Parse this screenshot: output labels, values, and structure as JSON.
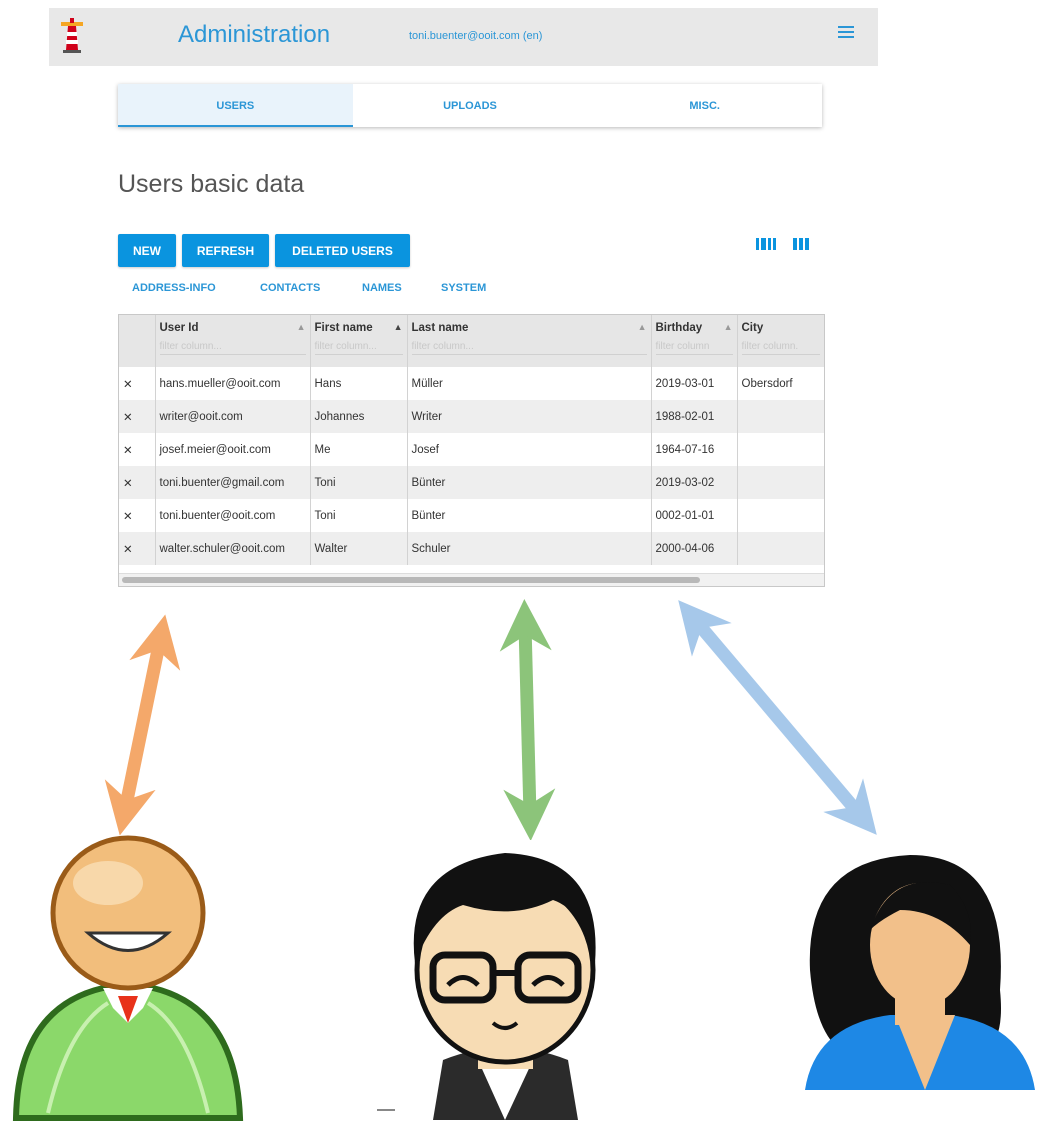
{
  "header": {
    "title": "Administration",
    "user": "toni.buenter@ooit.com (en)",
    "menu_icon": "hamburger-icon",
    "logo_icon": "lighthouse-logo-icon"
  },
  "tabs": [
    {
      "label": "USERS",
      "active": true
    },
    {
      "label": "UPLOADS",
      "active": false
    },
    {
      "label": "MISC.",
      "active": false
    }
  ],
  "page_title": "Users basic data",
  "toolbar": {
    "new_label": "NEW",
    "refresh_label": "REFRESH",
    "deleted_label": "DELETED USERS",
    "view_icons": [
      "columns-view-icon",
      "grid-view-icon"
    ]
  },
  "column_groups": [
    "ADDRESS-INFO",
    "CONTACTS",
    "NAMES",
    "SYSTEM"
  ],
  "table": {
    "columns": [
      {
        "label": "User Id",
        "filter": "filter column..."
      },
      {
        "label": "First name",
        "filter": "filter column..."
      },
      {
        "label": "Last name",
        "filter": "filter column..."
      },
      {
        "label": "Birthday",
        "filter": "filter column"
      },
      {
        "label": "City",
        "filter": "filter column."
      }
    ],
    "rows": [
      {
        "user_id": "hans.mueller@ooit.com",
        "first": "Hans",
        "last": "Müller",
        "birthday": "2019-03-01",
        "city": "Obersdorf"
      },
      {
        "user_id": "writer@ooit.com",
        "first": "Johannes",
        "last": "Writer",
        "birthday": "1988-02-01",
        "city": ""
      },
      {
        "user_id": "josef.meier@ooit.com",
        "first": "Me",
        "last": "Josef",
        "birthday": "1964-07-16",
        "city": ""
      },
      {
        "user_id": "toni.buenter@gmail.com",
        "first": "Toni",
        "last": "Bünter",
        "birthday": "2019-03-02",
        "city": ""
      },
      {
        "user_id": "toni.buenter@ooit.com",
        "first": "Toni",
        "last": "Bünter",
        "birthday": "0002-01-01",
        "city": ""
      },
      {
        "user_id": "walter.schuler@ooit.com",
        "first": "Walter",
        "last": "Schuler",
        "birthday": "2000-04-06",
        "city": ""
      }
    ],
    "delete_glyph": "✕"
  },
  "colors": {
    "accent": "#0a94df",
    "arrow_orange": "#f4a86a",
    "arrow_green": "#8cc47a",
    "arrow_blue": "#a6c8ea"
  },
  "personas": [
    "admin-user-icon",
    "developer-user-icon",
    "business-user-icon"
  ]
}
